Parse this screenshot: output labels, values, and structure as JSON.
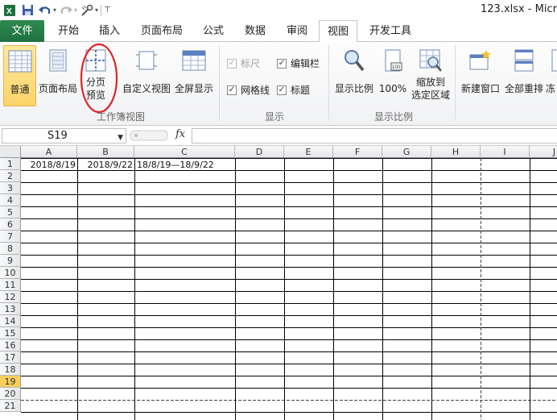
{
  "window": {
    "title": "123.xlsx  -  Micr"
  },
  "qat": [
    "excel-logo-icon",
    "save-icon",
    "undo-icon",
    "redo-icon",
    "customize-icon"
  ],
  "tabs": [
    {
      "label": "文件"
    },
    {
      "label": "开始"
    },
    {
      "label": "插入"
    },
    {
      "label": "页面布局"
    },
    {
      "label": "公式"
    },
    {
      "label": "数据"
    },
    {
      "label": "审阅"
    },
    {
      "label": "视图"
    },
    {
      "label": "开发工具"
    }
  ],
  "active_tab": "视图",
  "ribbon": {
    "workbook_views": {
      "label": "工作簿视图",
      "normal": "普通",
      "page_layout": "页面布局",
      "page_break_line1": "分页",
      "page_break_line2": "预览",
      "custom_views": "自定义视图",
      "full_screen": "全屏显示"
    },
    "show": {
      "label": "显示",
      "ruler": "标尺",
      "formula_bar": "编辑栏",
      "gridlines": "网格线",
      "headings": "标题",
      "checked_mark": "✓"
    },
    "zoom": {
      "label": "显示比例",
      "zoom": "显示比例",
      "hundred": "100%",
      "zoom_selection_line1": "缩放到",
      "zoom_selection_line2": "选定区域"
    },
    "window": {
      "new_window": "新建窗口",
      "arrange_all": "全部重排",
      "freeze": "冻"
    }
  },
  "formula_bar": {
    "name_box": "S19",
    "fx": "fx",
    "value": ""
  },
  "grid": {
    "columns": [
      "A",
      "B",
      "C",
      "D",
      "E",
      "F",
      "G",
      "H",
      "I",
      "J"
    ],
    "rows": [
      "1",
      "2",
      "3",
      "4",
      "5",
      "6",
      "7",
      "8",
      "9",
      "10",
      "11",
      "12",
      "13",
      "14",
      "15",
      "16",
      "17",
      "18",
      "19",
      "20",
      "21"
    ],
    "selected_row": "19",
    "cells": {
      "A1": "2018/8/19",
      "B1": "2018/9/22",
      "C1": "18/8/19—18/9/22"
    }
  },
  "colors": {
    "file_tab": "#217346",
    "selected_button": "#fcd36a",
    "annotation_circle": "#e0242a",
    "selected_row_header": "#f6cf5b"
  }
}
